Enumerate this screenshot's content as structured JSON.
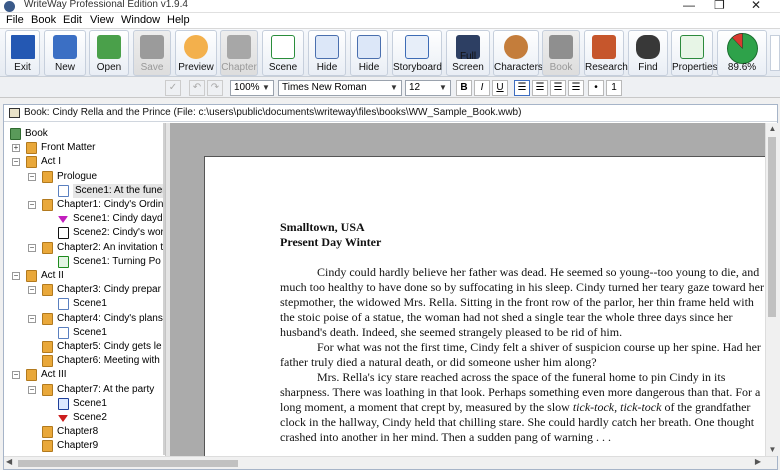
{
  "window": {
    "title": "WriteWay Professional Edition v1.9.4",
    "controls": {
      "minimize": "—",
      "restore": "❐",
      "close": "✕"
    }
  },
  "menu": [
    "File",
    "Book",
    "Edit",
    "View",
    "Window",
    "Help"
  ],
  "toolbar": {
    "buttons": [
      {
        "label": "Exit",
        "icon": "exit-door-icon",
        "enabled": true
      },
      {
        "label": "New",
        "icon": "new-book-icon",
        "enabled": true
      },
      {
        "label": "Open",
        "icon": "open-book-icon",
        "enabled": true
      },
      {
        "label": "Save",
        "icon": "save-disk-icon",
        "enabled": false
      },
      {
        "label": "Preview",
        "icon": "preview-magnifier-icon",
        "enabled": true
      },
      {
        "label": "Chapter",
        "icon": "chapter-folder-icon",
        "enabled": false
      },
      {
        "label": "Scene",
        "icon": "scene-add-icon",
        "enabled": true
      },
      {
        "label": "Hide",
        "icon": "hide-single-icon",
        "enabled": true
      },
      {
        "label": "Hide",
        "icon": "hide-multiple-icon",
        "enabled": true
      },
      {
        "label": "Storyboard",
        "icon": "storyboard-grid-icon",
        "enabled": true
      },
      {
        "label": "Full Screen",
        "icon": "monitor-icon",
        "enabled": true
      },
      {
        "label": "Characters",
        "icon": "characters-people-icon",
        "enabled": true
      },
      {
        "label": "Book",
        "icon": "book-icon",
        "enabled": false
      },
      {
        "label": "Research",
        "icon": "research-toolbox-icon",
        "enabled": true
      },
      {
        "label": "Find",
        "icon": "binoculars-icon",
        "enabled": true
      },
      {
        "label": "Properties",
        "icon": "properties-icon",
        "enabled": true
      }
    ],
    "progress": {
      "label": "89.6%",
      "value": 0.896,
      "icon": "pie-progress-icon"
    }
  },
  "format_bar": {
    "zoom": "100%",
    "font": "Times New Roman",
    "size": "12",
    "bold": "B",
    "italic": "I",
    "underline": "U"
  },
  "document": {
    "title": "Book: Cindy Rella and the Prince (File: c:\\users\\public\\documents\\writeway\\files\\books\\WW_Sample_Book.wwb)"
  },
  "tree": [
    {
      "label": "Book",
      "icon": "book-root-icon",
      "level": 0,
      "expander": ""
    },
    {
      "label": "Front Matter",
      "icon": "folder-icon",
      "level": 1,
      "expander": "+"
    },
    {
      "label": "Act I",
      "icon": "folder-icon",
      "level": 1,
      "expander": "−"
    },
    {
      "label": "Prologue",
      "icon": "folder-icon",
      "level": 2,
      "expander": "−"
    },
    {
      "label": "Scene1: At the funer",
      "icon": "scene-page-icon",
      "level": 3,
      "expander": "",
      "selected": true
    },
    {
      "label": "Chapter1: Cindy's Ordin",
      "icon": "folder-icon",
      "level": 2,
      "expander": "−"
    },
    {
      "label": "Scene1: Cindy dayd",
      "icon": "magenta-flag-icon",
      "level": 3,
      "expander": ""
    },
    {
      "label": "Scene2: Cindy's wor",
      "icon": "black-page-icon",
      "level": 3,
      "expander": ""
    },
    {
      "label": "Chapter2: An invitation t",
      "icon": "folder-icon",
      "level": 2,
      "expander": "−"
    },
    {
      "label": "Scene1: Turning Po",
      "icon": "green-page-icon",
      "level": 3,
      "expander": ""
    },
    {
      "label": "Act II",
      "icon": "folder-icon",
      "level": 1,
      "expander": "−"
    },
    {
      "label": "Chapter3: Cindy prepar",
      "icon": "folder-icon",
      "level": 2,
      "expander": "−"
    },
    {
      "label": "Scene1",
      "icon": "scene-page-icon",
      "level": 3,
      "expander": ""
    },
    {
      "label": "Chapter4: Cindy's plans",
      "icon": "folder-icon",
      "level": 2,
      "expander": "−"
    },
    {
      "label": "Scene1",
      "icon": "scene-page-icon",
      "level": 3,
      "expander": ""
    },
    {
      "label": "Chapter5: Cindy gets le",
      "icon": "folder-icon",
      "level": 2,
      "expander": ""
    },
    {
      "label": "Chapter6: Meeting with",
      "icon": "folder-icon",
      "level": 2,
      "expander": ""
    },
    {
      "label": "Act III",
      "icon": "folder-icon",
      "level": 1,
      "expander": "−"
    },
    {
      "label": "Chapter7: At the party",
      "icon": "folder-icon",
      "level": 2,
      "expander": "−"
    },
    {
      "label": "Scene1",
      "icon": "blue-page-icon",
      "level": 3,
      "expander": ""
    },
    {
      "label": "Scene2",
      "icon": "red-flag-icon",
      "level": 3,
      "expander": ""
    },
    {
      "label": "Chapter8",
      "icon": "folder-icon",
      "level": 2,
      "expander": ""
    },
    {
      "label": "Chapter9",
      "icon": "folder-icon",
      "level": 2,
      "expander": ""
    }
  ],
  "editor": {
    "heading1": "Smalltown, USA",
    "heading2": "Present Day Winter",
    "para1": "Cindy could hardly believe her father was dead. He seemed so young--too young to die, and much too healthy to have done so by suffocating in his sleep. Cindy turned her teary gaze toward her stepmother, the widowed Mrs. Rella. Sitting in the front row of the parlor, her thin frame held with the stoic poise of a statue, the woman had not shed a single tear the whole three days since her husband's death. Indeed, she seemed strangely pleased to be rid of him.",
    "para2": "For what was not the first time, Cindy felt a shiver of suspicion course up her spine. Had her father truly died a natural death, or did someone usher him along?",
    "para3_a": "Mrs. Rella's icy stare reached across the space of the funeral home to pin Cindy in its sharpness. There was loathing in that look. Perhaps something even more dangerous than that. For a long moment, a moment that crept by, measured by the slow ",
    "para3_italic": "tick-tock, tick-tock",
    "para3_b": " of the grandfather clock in the hallway, Cindy held that chilling stare. She could hardly catch her breath. One thought crashed into another in her mind. Then a sudden pang of warning . . ."
  }
}
